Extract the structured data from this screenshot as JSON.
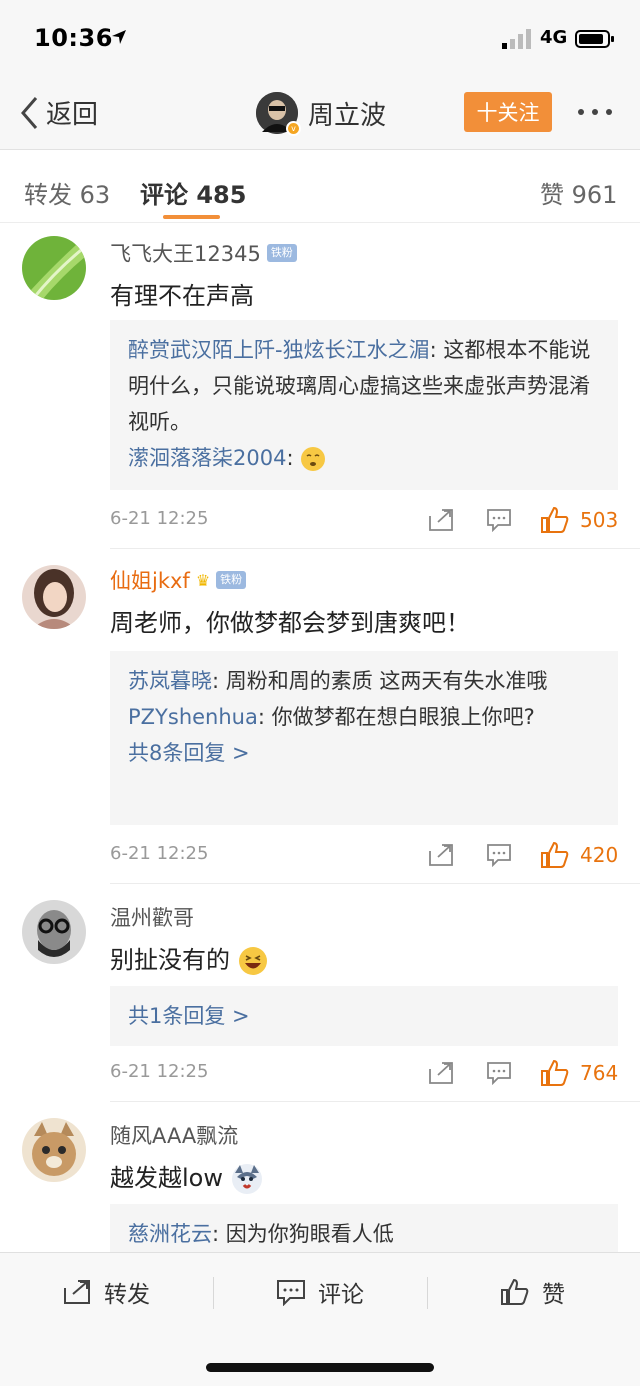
{
  "status_bar": {
    "time": "10:36",
    "network": "4G"
  },
  "nav": {
    "back_label": "返回",
    "profile_name": "周立波",
    "follow_label": "十关注"
  },
  "tabs": {
    "repost": "转发 63",
    "comments": "评论 485",
    "likes": "赞 961"
  },
  "comments": [
    {
      "user": "飞飞大王12345",
      "badge": "铁粉",
      "text": "有理不在声高",
      "replies": [
        {
          "name": "醉赏武汉陌上阡-独炫长江水之湄",
          "text": ": 这都根本不能说明什么，只能说玻璃周心虚搞这些来虚张声势混淆视听。"
        },
        {
          "name": "潆洄落落柒2004",
          "text": ": "
        }
      ],
      "date": "6-21 12:25",
      "likes": "503"
    },
    {
      "user": "仙姐jkxf",
      "badge": "铁粉",
      "text": "周老师，你做梦都会梦到唐爽吧！",
      "replies": [
        {
          "name": "苏岚暮晓",
          "text": ": 周粉和周的素质  这两天有失水准哦"
        },
        {
          "name": "PZYshenhua",
          "text": ": 你做梦都在想白眼狼上你吧?"
        }
      ],
      "more": "共8条回复 >",
      "date": "6-21 12:25",
      "likes": "420"
    },
    {
      "user": "温州歡哥",
      "text": "别扯没有的",
      "more": "共1条回复 >",
      "date": "6-21 12:25",
      "likes": "764"
    },
    {
      "user": "随风AAA飘流",
      "text": "越发越low",
      "replies": [
        {
          "name": "慈洲花云",
          "text": ": 因为你狗眼看人低"
        }
      ]
    }
  ],
  "bottom_bar": {
    "repost": "转发",
    "comment": "评论",
    "like": "赞"
  },
  "colors": {
    "accent": "#f28f39",
    "link": "#4a6fa0",
    "like_count": "#e8730e"
  }
}
